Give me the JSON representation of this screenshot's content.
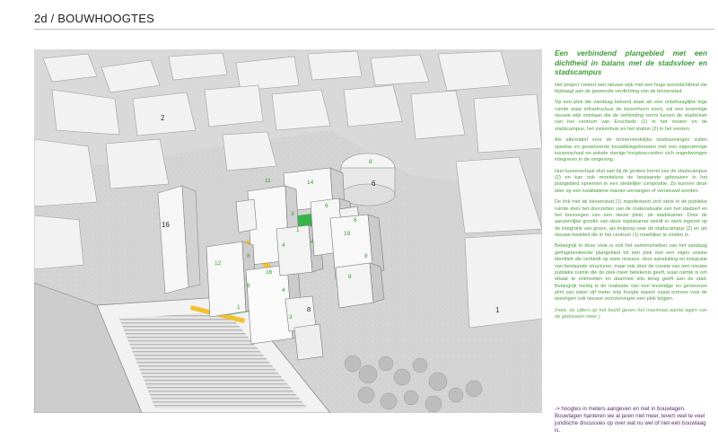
{
  "page": {
    "title": "2d / BOUWHOOGTES"
  },
  "map": {
    "area_labels": [
      "1",
      "2",
      "6"
    ],
    "height_labels": [
      "14",
      "11",
      "16",
      "12",
      "16",
      "8",
      "8",
      "4",
      "4",
      "1",
      "3",
      "6",
      "6",
      "19",
      "8",
      "8",
      "8",
      "4",
      "1",
      "3",
      "8"
    ]
  },
  "text": {
    "headline": "Een verbindend plangebied met een dichtheid in balans met de stadsvloer en stadscampus",
    "paragraphs": [
      "Het project creeert een nieuwe wijk met een hoge woondichtheid die bijdraagt aan de gewenste verdichting van de binnenstad.",
      "Op een plek die vandaag bekend staat als een onbehaaglijke lege ruimte waar infrastructuur de bovenhoon voert, zal een levendige nieuwe wijk ontstaan die de verbinding vormt tussen de stadsvloer van het centrum van Enschede (1) in het oosten en de stadscampus, het ziekenhuis en het station (2) in het westen.",
      "Als alternatief voor de binnenstedelijke stadswoningen zullen speelse en gesarkeerde bouwblokgebouwen met een eigenzinnige tussenschaal en enkele stevige hoogteaccenten zich ongedwongen integreren in de omgeving.",
      "Hun tussenschaal sluit aan bij de grotere korrel van de stadscampus (2) en kan ook moeiteloos de bestaande gebouwen in het plangebied opnemen in een stedelijke compositie. Zo kunnen deze later op een kwalitatieve manier vervangen of vernieuwd worden.",
      "De link met de binnenstad (1) manifesteert zich sterk in de publieke ruimte door het doorzetten van de materialisatie van het stadserf en het toevoegen van een nieuw plein, de stadskamer. Door de aanzienlijke grootte van deze stadskamer wordt er sterk ingezet op de integratie van groen, als knipoog naar de stadscampus (2) en als nieuwe kwaliteit die in het centrum (1) moeilijker te vinden is.",
      "Belangrijk in deze visie is ook het samensmelten van het vandaag gefragmenteerde plangebied tot een plek met een eigen unieke identiteit die verbindt op twee niveaus: door aansluiting en integratie van bestaande structuren, maar ook door de creatie van een nieuwe publieke ruimte die de plek meer betekenis geeft, waar ruimte is om elkaar te ontmoeten en daarmee iets terug geeft aan de stad. Belangrijk hierbij is de realisatie van een levendige en genereuze plint van zeker vijf meter vrije hoogte waarin naast entrees voor de woningen ook nieuwe voorzieningen een plek krijgen."
    ],
    "note": "(nota: de cijfers op het beeld geven het maximaal aantal lagen van de gebouwen weer )",
    "footer": [
      "-> hoogtes in meters aangeven en niet in bouwlagen.",
      "Bouwlagen hanteren we al jaren niet meer, levert veel te veel juridische discussies op over wat nu wel of niet een bouwlaag is."
    ]
  },
  "colors": {
    "headline": "#3f9a3a",
    "body": "#4a9a3c",
    "footer": "#5a2d6e",
    "green_space": "#39b34a",
    "accent_yellow": "#f2c12e"
  }
}
